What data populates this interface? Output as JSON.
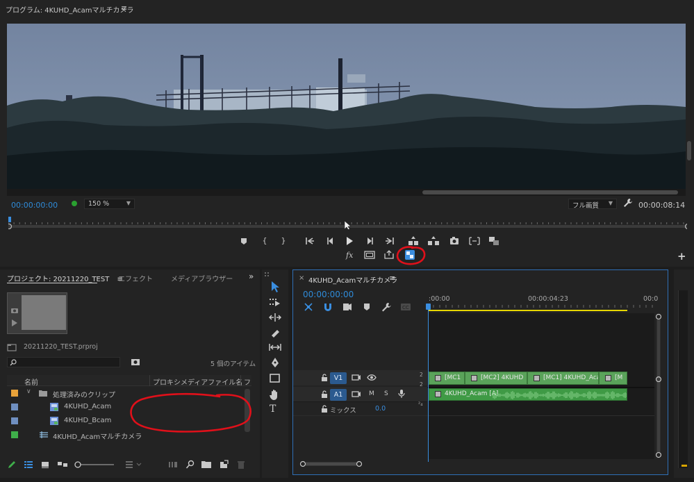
{
  "program": {
    "title": "プログラム: 4KUHD_Acamマルチカメラ",
    "menu_glyph": "≡",
    "timecode_left": "00:00:00:00",
    "zoom": "150 %",
    "resolution": "フル画質",
    "timecode_right": "00:00:08:14",
    "plus_glyph": "+"
  },
  "project": {
    "tab_label": "プロジェクト: 20211220_TEST",
    "tab_menu": "≡",
    "effects_tab": "エフェクト",
    "media_tab": "メディアブラウザー",
    "expand_glyph": "»",
    "file_name": "20211220_TEST.prproj",
    "item_count": "5 個のアイテム",
    "columns": [
      "名前",
      "プロキシメディアファイル名",
      "フ"
    ],
    "rows": [
      {
        "label": "処理済みのクリップ",
        "color": "#e8a23a"
      },
      {
        "label": "4KUHD_Acam",
        "color": "#6f8fc0"
      },
      {
        "label": "4KUHD_Bcam",
        "color": "#6f8fc0"
      },
      {
        "label": "4KUHD_Acamマルチカメラ",
        "color": "#3fae4a"
      }
    ]
  },
  "sequence": {
    "close_glyph": "×",
    "title": "4KUHD_Acamマルチカメラ",
    "menu_glyph": "≡",
    "timecode": "00:00:00:00",
    "ruler": [
      ":00:00",
      "00:00:04:23",
      "00:0"
    ],
    "tracks": {
      "v1": "V1",
      "a1": "A1",
      "mute": "M",
      "solo": "S",
      "channel_v": "2",
      "channel_a": "2",
      "mix_label": "ミックス",
      "mix_value": "0.0"
    },
    "video_clips": [
      "[MC1",
      "[MC2] 4KUHD",
      "[MC1] 4KUHD_Aca",
      "[M"
    ],
    "audio_clip": "4KUHD_Acam [A]"
  },
  "colors": {
    "accent_blue": "#2f8bd8",
    "clip_green": "#5aa35a",
    "audio_green": "#3f9a45",
    "annotation_red": "#e0101a",
    "in_out_yellow": "#e6d600"
  }
}
